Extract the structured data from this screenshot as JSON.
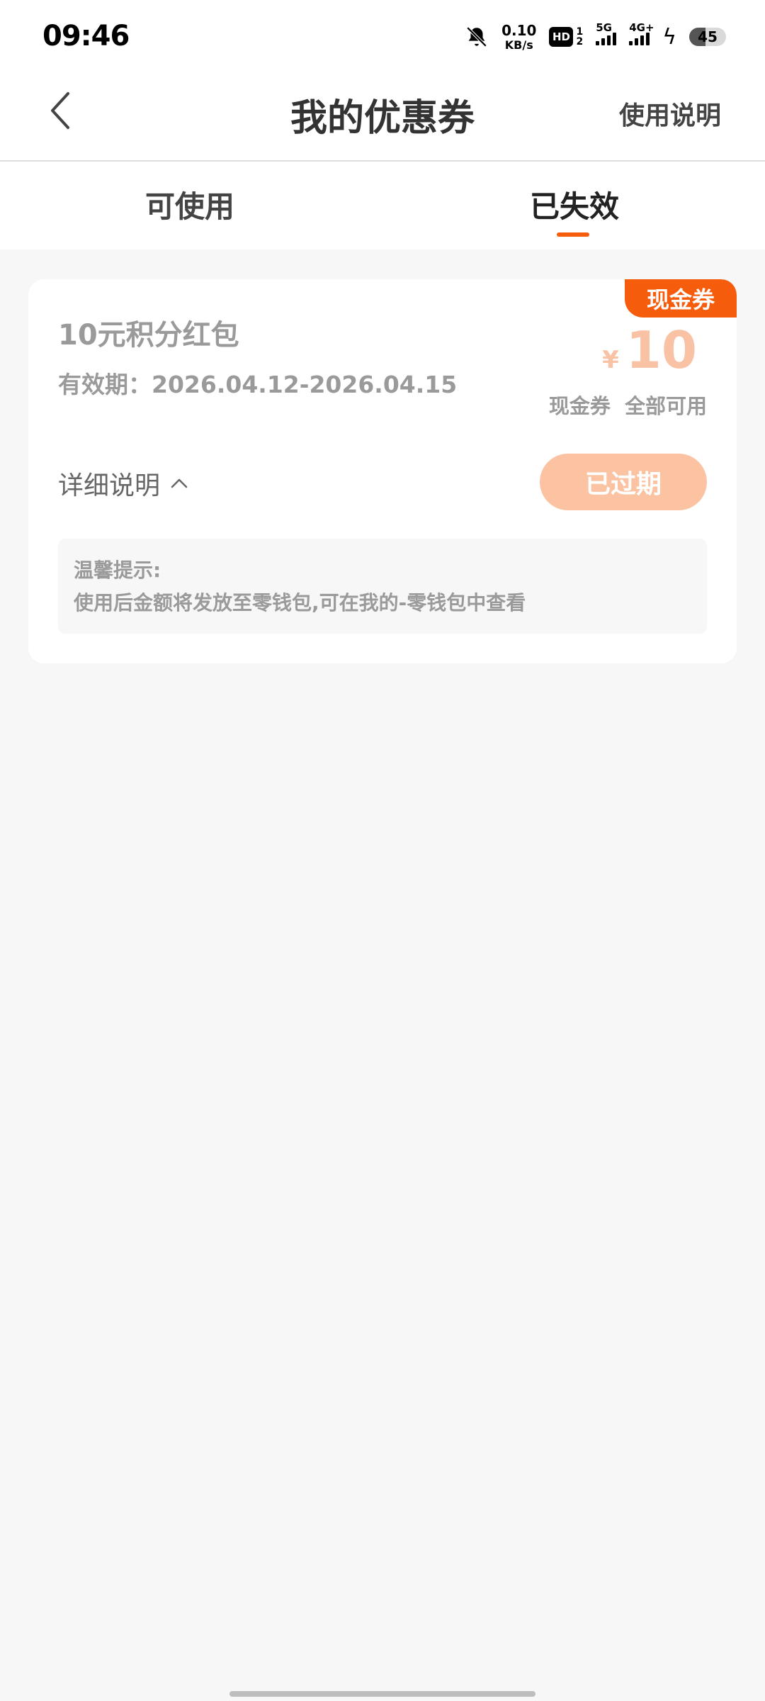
{
  "status_bar": {
    "time": "09:46",
    "net_speed_value": "0.10",
    "net_speed_unit": "KB/s",
    "hd_label": "HD",
    "hd_sub_top": "1",
    "hd_sub_bottom": "2",
    "signal_1_label": "5G",
    "signal_2_label": "4G+",
    "battery_level": "45",
    "icons": [
      "bell-off-icon",
      "hd-icon",
      "signal-5g-icon",
      "signal-4g-icon",
      "charging-icon",
      "battery-icon"
    ]
  },
  "header": {
    "title": "我的优惠券",
    "help_link": "使用说明"
  },
  "tabs": {
    "available": "可使用",
    "expired": "已失效",
    "active": "expired",
    "accent_color": "#f55c0c"
  },
  "coupon": {
    "badge": "现金券",
    "name": "10元积分红包",
    "validity": "有效期：2026.04.12-2026.04.15",
    "currency_symbol": "¥",
    "amount": "10",
    "scope": "现金券 全部可用",
    "detail_label": "详细说明",
    "status_button": "已过期",
    "tips_title": "温馨提示:",
    "tips_body": "使用后金额将发放至零钱包,可在我的-零钱包中查看"
  },
  "colors": {
    "accent": "#f55c0c",
    "expired_button": "#fbc3a2",
    "muted_text": "#9a9a9a",
    "page_background": "#f7f7f7"
  }
}
